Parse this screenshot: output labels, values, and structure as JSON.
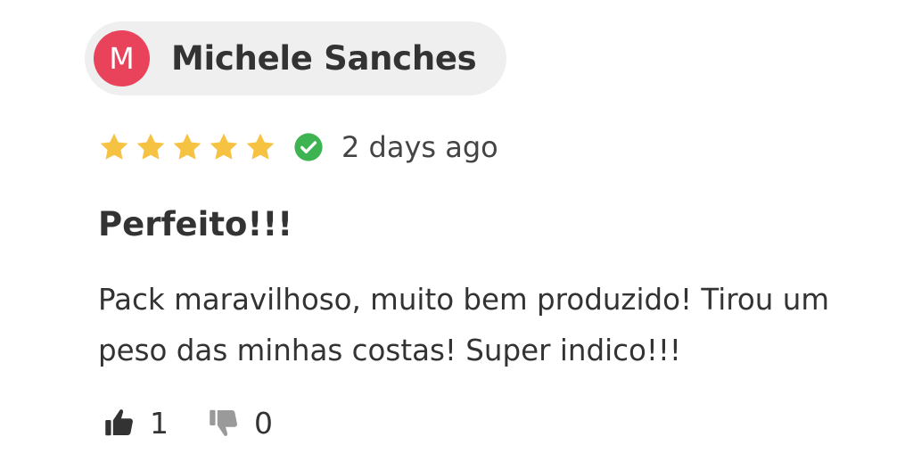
{
  "review": {
    "author": {
      "initial": "M",
      "name": "Michele Sanches",
      "avatar_color": "#e8435a"
    },
    "rating": {
      "stars": 5,
      "max": 5,
      "star_color": "#f5c242",
      "star_icon": "star-icon"
    },
    "verified": {
      "icon": "check-circle-icon",
      "color": "#3db451"
    },
    "date": "2 days ago",
    "title": "Perfeito!!!",
    "body": "Pack maravilhoso, muito bem produzido! Tirou um peso das minhas costas! Super indico!!!",
    "helpful": {
      "up_icon": "thumbs-up-icon",
      "up_count": "1",
      "up_color": "#333333",
      "down_icon": "thumbs-down-icon",
      "down_count": "0",
      "down_color": "#9a9a9a"
    }
  }
}
